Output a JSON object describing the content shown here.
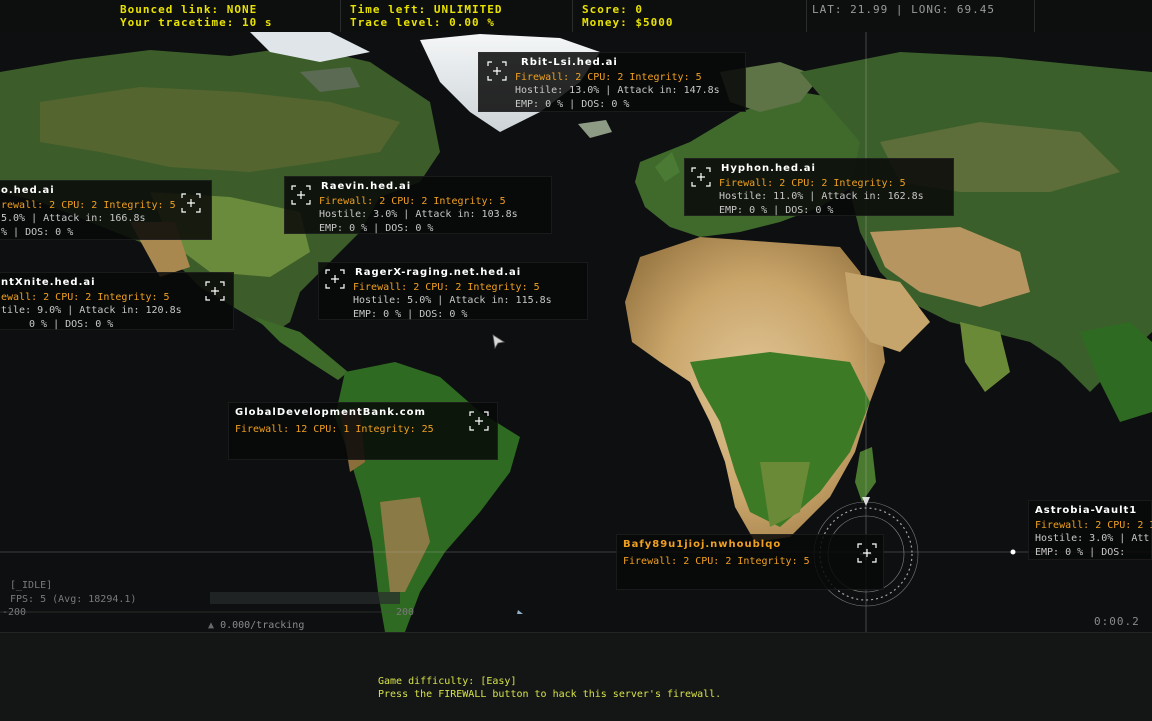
{
  "hud": {
    "bounced_link": "Bounced link: NONE",
    "trace_time": "Your tracetime: 10 s",
    "time_left": "Time left: UNLIMITED",
    "trace_level": "Trace level: 0.00 %",
    "score": "Score: 0",
    "money": "Money: $5000",
    "coords": "LAT: 21.99 | LONG: 69.45"
  },
  "nodes": [
    {
      "id": "rbit",
      "name": "Rbit-Lsi.hed.ai",
      "stats": "Firewall: 2 CPU: 2 Integrity: 5",
      "hostile": "Hostile: 13.0% | Attack in: 147.8s",
      "emp": "EMP:   0 % | DOS:   0 %"
    },
    {
      "id": "hyphon",
      "name": "Hyphon.hed.ai",
      "stats": "Firewall: 2 CPU: 2 Integrity: 5",
      "hostile": "Hostile: 11.0% | Attack in: 162.8s",
      "emp": "EMP:   0 % | DOS:   0 %"
    },
    {
      "id": "o",
      "name": "o.hed.ai",
      "stats": "rewall: 2 CPU: 2 Integrity: 5",
      "hostile": "5.0% | Attack in: 166.8s",
      "emp": "% | DOS:   0 %"
    },
    {
      "id": "raevin",
      "name": "Raevin.hed.ai",
      "stats": "Firewall: 2 CPU: 2 Integrity: 5",
      "hostile": "Hostile: 3.0% | Attack in: 103.8s",
      "emp": "EMP:   0 % | DOS:   0 %"
    },
    {
      "id": "ntxnite",
      "name": "ntXnite.hed.ai",
      "stats": "ewall: 2 CPU: 2 Integrity: 5",
      "hostile": "tile: 9.0% | Attack in: 120.8s",
      "emp": "0 % | DOS:   0 %"
    },
    {
      "id": "ragerx",
      "name": "RagerX-raging.net.hed.ai",
      "stats": "Firewall: 2 CPU: 2 Integrity: 5",
      "hostile": "Hostile: 5.0% | Attack in: 115.8s",
      "emp": "EMP:   0 % | DOS:   0 %"
    },
    {
      "id": "gdb",
      "name": "GlobalDevelopmentBank.com",
      "stats": "Firewall: 12 CPU: 1 Integrity: 25"
    },
    {
      "id": "bafy",
      "name": "Bafy89u1jioj.nwhoublqo",
      "stats": "Firewall: 2 CPU: 2 Integrity: 5"
    },
    {
      "id": "astrobia",
      "name": "Astrobia-Vault1",
      "stats": "Firewall: 2 CPU: 2 Inte",
      "hostile": "Hostile: 3.0% | Att",
      "emp": "EMP:   0 % | DOS:"
    }
  ],
  "overlay": {
    "idle": "[_IDLE]",
    "fps": "FPS:   5 (Avg: 18294.1)",
    "axis_left": "-200",
    "axis_right": "200",
    "tracking": "0.000/tracking",
    "timer": "0:00.2"
  },
  "messages": {
    "line1": "Game difficulty: [Easy]",
    "line2": "Press the FIREWALL button to hack this server's firewall."
  },
  "colors": {
    "hud_yellow": "#e8e200",
    "stats_orange": "#f0a020",
    "message_green": "#d6e24a"
  }
}
